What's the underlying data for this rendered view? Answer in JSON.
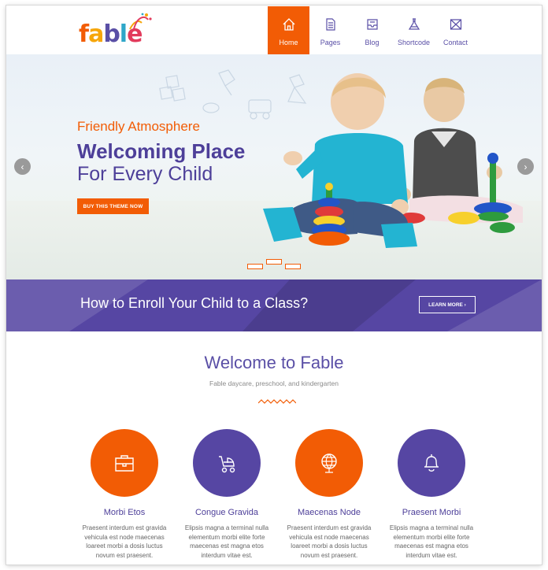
{
  "brand": {
    "name": "fable",
    "letters": [
      "f",
      "a",
      "b",
      "l",
      "e"
    ],
    "letter_colors": [
      "#f25c05",
      "#f6a60a",
      "#5a4fa6",
      "#2fa7c9",
      "#e23b5c"
    ]
  },
  "nav": {
    "items": [
      {
        "label": "Home",
        "icon": "home-icon",
        "active": true
      },
      {
        "label": "Pages",
        "icon": "document-icon",
        "active": false
      },
      {
        "label": "Blog",
        "icon": "inbox-icon",
        "active": false
      },
      {
        "label": "Shortcode",
        "icon": "flask-icon",
        "active": false
      },
      {
        "label": "Contact",
        "icon": "envelope-icon",
        "active": false
      }
    ]
  },
  "hero": {
    "kicker": "Friendly Atmosphere",
    "title": "Welcoming Place",
    "subtitle": "For Every Child",
    "button_label": "BUY THIS THEME NOW",
    "prev_icon": "‹",
    "next_icon": "›",
    "slides": 3
  },
  "enroll": {
    "text": "How to Enroll Your Child to a Class?",
    "button_label": "LEARN MORE  ›"
  },
  "welcome": {
    "title": "Welcome to Fable",
    "subtitle": "Fable daycare, preschool, and kindergarten"
  },
  "features": [
    {
      "title": "Morbi Etos",
      "icon": "briefcase-icon",
      "color": "#f25c05",
      "lines": [
        "Praesent interdum est gravida",
        "vehicula est node maecenas",
        "loareet morbi a dosis luctus",
        "novum est praesent."
      ]
    },
    {
      "title": "Congue Gravida",
      "icon": "stroller-icon",
      "color": "#5646a3",
      "lines": [
        "Elipsis magna a terminal nulla",
        "elementum morbi elite forte",
        "maecenas est magna etos",
        "interdum vitae est."
      ]
    },
    {
      "title": "Maecenas Node",
      "icon": "globe-icon",
      "color": "#f25c05",
      "lines": [
        "Praesent interdum est gravida",
        "vehicula est node maecenas",
        "loareet morbi a dosis luctus",
        "novum est praesent."
      ]
    },
    {
      "title": "Praesent Morbi",
      "icon": "bell-icon",
      "color": "#5646a3",
      "lines": [
        "Elipsis magna a terminal nulla",
        "elementum morbi elite forte",
        "maecenas est magna etos",
        "interdum vitae est."
      ]
    }
  ],
  "colors": {
    "accent": "#f25c05",
    "brand_purple": "#5646a3"
  }
}
